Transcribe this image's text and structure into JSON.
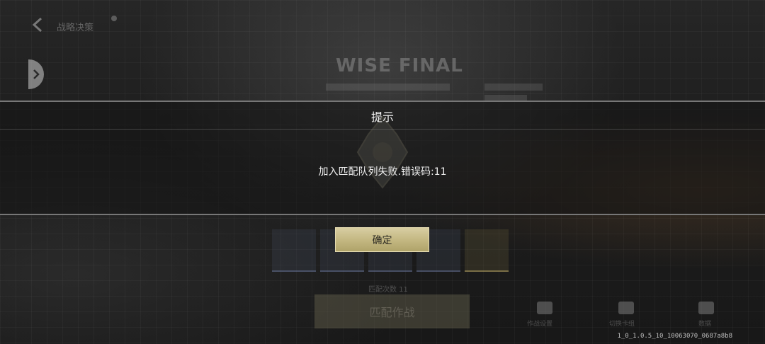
{
  "background": {
    "back_title": "战略决策",
    "banner_title": "WISE FINAL",
    "match_button_label": "匹配作战",
    "match_subtitle": "匹配次数 11",
    "bottom_icons": [
      {
        "name": "settings",
        "label": "作战设置"
      },
      {
        "name": "switch",
        "label": "切换卡组"
      },
      {
        "name": "stats",
        "label": "数据"
      }
    ]
  },
  "dialog": {
    "title": "提示",
    "message": "加入匹配队列失败.错误码:11",
    "confirm_label": "确定"
  },
  "footer": {
    "version": "1_0_1.0.5_10_10063070_0687a8b8"
  },
  "colors": {
    "accent_gold": "#c2b680",
    "dialog_border": "#777777"
  }
}
